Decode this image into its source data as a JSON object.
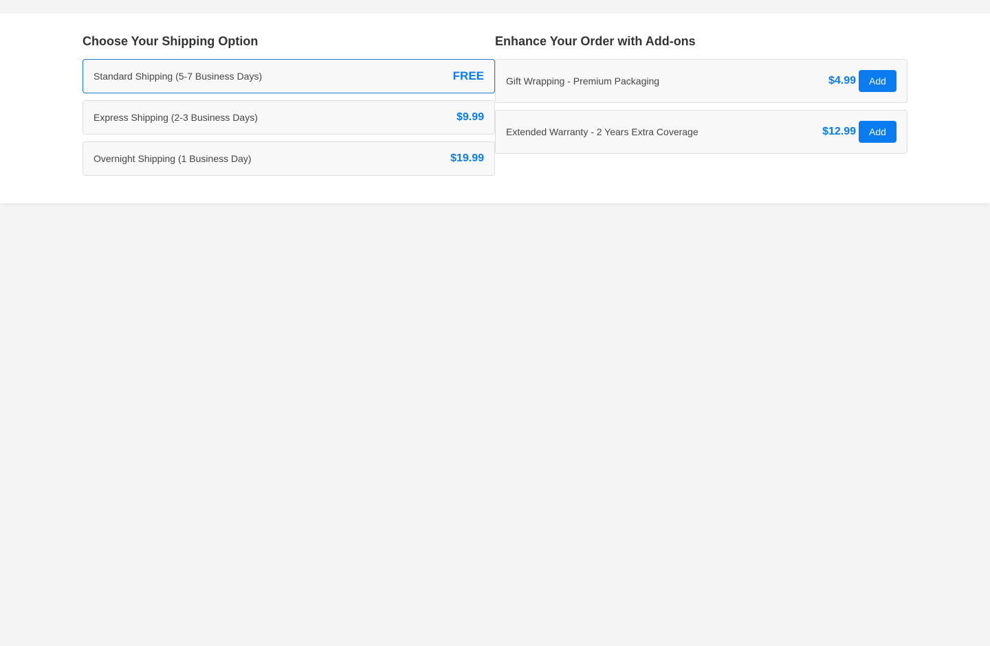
{
  "shipping": {
    "title": "Choose Your Shipping Option",
    "options": [
      {
        "label": "Standard Shipping (5-7 Business Days)",
        "price": "FREE",
        "selected": true
      },
      {
        "label": "Express Shipping (2-3 Business Days)",
        "price": "$9.99",
        "selected": false
      },
      {
        "label": "Overnight Shipping (1 Business Day)",
        "price": "$19.99",
        "selected": false
      }
    ]
  },
  "addons": {
    "title": "Enhance Your Order with Add-ons",
    "items": [
      {
        "label": "Gift Wrapping - Premium Packaging",
        "price": "$4.99",
        "button": "Add"
      },
      {
        "label": "Extended Warranty - 2 Years Extra Coverage",
        "price": "$12.99",
        "button": "Add"
      }
    ]
  },
  "colors": {
    "accent": "#0a7cf0",
    "selected_border": "#1a7ad9",
    "card_bg": "#f8f8f8",
    "page_bg": "#f4f4f4"
  }
}
